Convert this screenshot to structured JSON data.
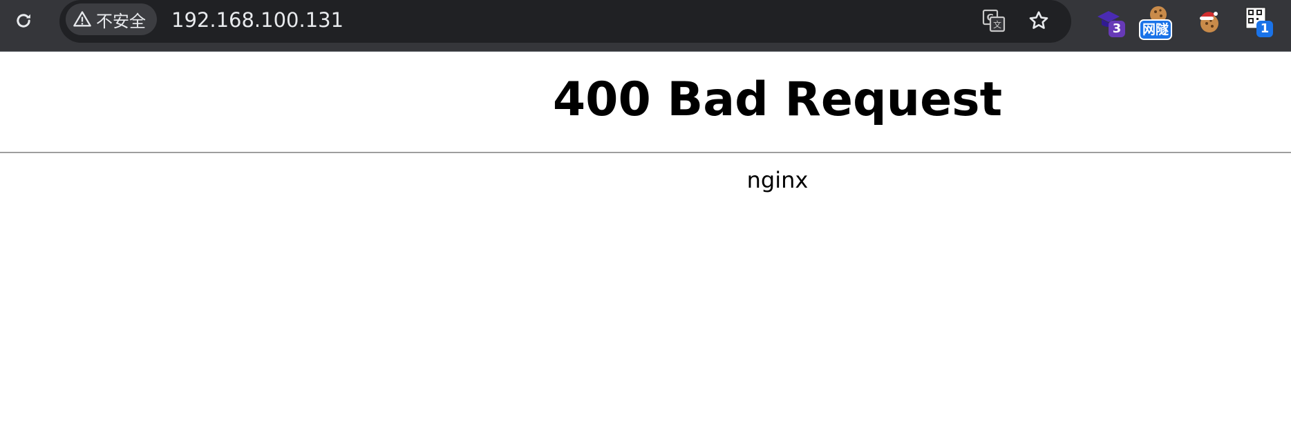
{
  "browser": {
    "security_label": "不安全",
    "url": "192.168.100.131",
    "icons": {
      "reload": "reload-icon",
      "warning": "warning-icon",
      "translate": "translate-icon",
      "bookmark": "bookmark-star-icon"
    },
    "extensions": [
      {
        "name": "purple-graduation-cap-extension",
        "badge": "3",
        "badge_color": "#673ab7"
      },
      {
        "name": "cookie-extension",
        "label": "网隧",
        "label_color": "#1a73e8"
      },
      {
        "name": "santa-cookie-extension"
      },
      {
        "name": "qr-code-extension",
        "badge": "1",
        "badge_color": "#1a73e8"
      }
    ]
  },
  "page": {
    "heading": "400 Bad Request",
    "server": "nginx"
  }
}
